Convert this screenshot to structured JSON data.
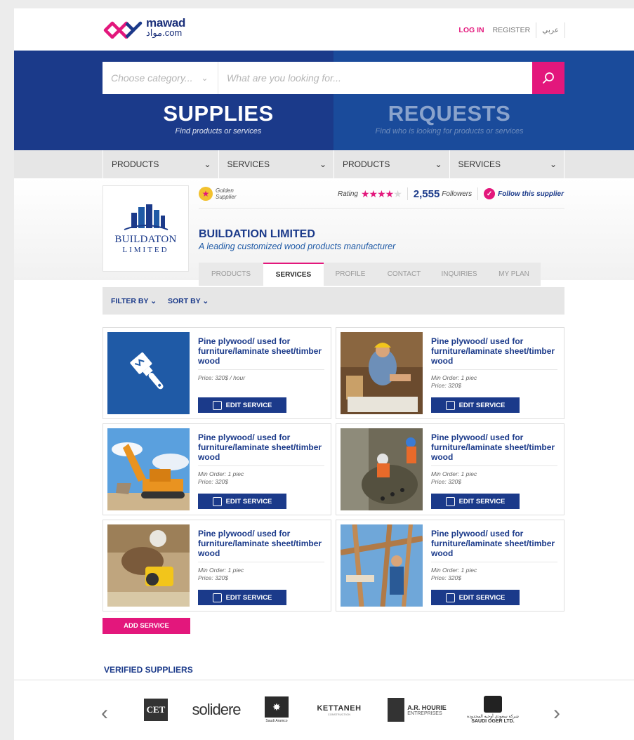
{
  "header": {
    "logo": {
      "en": "mawad",
      "ar": "مواد",
      "suffix": ".com"
    },
    "login": "LOG IN",
    "register": "REGISTER",
    "language": "عربي"
  },
  "search": {
    "category_placeholder": "Choose category...",
    "placeholder": "What are you looking for..."
  },
  "hero": {
    "supplies": {
      "title": "SUPPLIES",
      "subtitle": "Find products or services"
    },
    "requests": {
      "title": "REQUESTS",
      "subtitle": "Find who is looking for products or services"
    }
  },
  "catnav": [
    {
      "label": "PRODUCTS"
    },
    {
      "label": "SERVICES"
    },
    {
      "label": "PRODUCTS"
    },
    {
      "label": "SERVICES"
    }
  ],
  "supplier": {
    "badge_line1": "Golden",
    "badge_line2": "Supplier",
    "rating_label": "Rating",
    "rating_value": 4,
    "rating_max": 5,
    "followers_count": "2,555",
    "followers_label": "Followers",
    "follow_label": "Follow this supplier",
    "logo_line1": "BUILDATON",
    "logo_line2": "LIMITED",
    "name": "BUILDATION LIMITED",
    "tagline": "A leading customized wood products manufacturer"
  },
  "tabs": [
    {
      "label": "PRODUCTS",
      "active": false
    },
    {
      "label": "SERVICES",
      "active": true
    },
    {
      "label": "PROFILE",
      "active": false
    },
    {
      "label": "CONTACT",
      "active": false
    },
    {
      "label": "INQUIRIES",
      "active": false
    },
    {
      "label": "MY PLAN",
      "active": false
    }
  ],
  "filters": {
    "filter_by": "FILTER BY",
    "sort_by": "SORT BY"
  },
  "services": [
    {
      "title": "Pine plywood/ used for furniture/laminate sheet/timber wood",
      "meta1": "Price: 320$ / hour",
      "meta2": "",
      "image": "paintbrush-icon",
      "button": "EDIT SERVICE"
    },
    {
      "title": "Pine plywood/ used for furniture/laminate sheet/timber wood",
      "meta1": "Min Order: 1 piec",
      "meta2": "Price: 320$",
      "image": "worker-blueprint-photo",
      "button": "EDIT SERVICE"
    },
    {
      "title": "Pine plywood/ used for furniture/laminate sheet/timber wood",
      "meta1": "Min Order: 1 piec",
      "meta2": "Price: 320$",
      "image": "excavator-photo",
      "button": "EDIT SERVICE"
    },
    {
      "title": "Pine plywood/ used for furniture/laminate sheet/timber wood",
      "meta1": "Min Order: 1 piec",
      "meta2": "Price: 320$",
      "image": "excavation-site-photo",
      "button": "EDIT SERVICE"
    },
    {
      "title": "Pine plywood/ used for furniture/laminate sheet/timber wood",
      "meta1": "Min Order: 1 piec",
      "meta2": "Price: 320$",
      "image": "worker-saw-photo",
      "button": "EDIT SERVICE"
    },
    {
      "title": "Pine plywood/ used for furniture/laminate sheet/timber wood",
      "meta1": "Min Order: 1 piec",
      "meta2": "Price: 320$",
      "image": "timber-frame-photo",
      "button": "EDIT SERVICE"
    }
  ],
  "add_service": "ADD SERVICE",
  "verified": {
    "title": "VERIFIED SUPPLIERS",
    "logos": [
      {
        "name": "CET"
      },
      {
        "name": "solidere"
      },
      {
        "name": "Saudi Aramco"
      },
      {
        "name": "KETTANEH",
        "sub": "CONSTRUCTION"
      },
      {
        "name": "A.R. HOURIE",
        "sub": "ENTREPRISES"
      },
      {
        "name": "SAUDI OGER LTD.",
        "sub": "شركة سعودي أوجيه المحدودة"
      }
    ]
  },
  "colors": {
    "brand_blue": "#1b3a8a",
    "accent_pink": "#e3177c",
    "requests_blue": "#1a4b9b"
  }
}
